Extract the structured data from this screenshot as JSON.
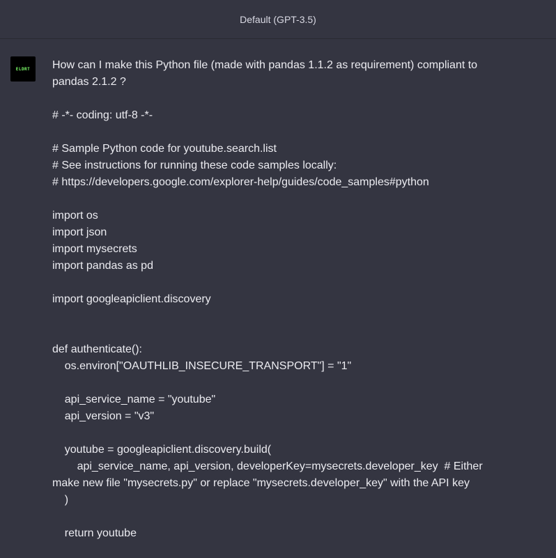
{
  "header": {
    "model_label": "Default (GPT-3.5)"
  },
  "user": {
    "avatar_text": "ELDRT"
  },
  "message": {
    "lines": [
      "How can I make this Python file (made with pandas 1.1.2 as requirement) compliant to pandas 2.1.2 ?",
      "",
      "# -*- coding: utf-8 -*-",
      "",
      "# Sample Python code for youtube.search.list",
      "# See instructions for running these code samples locally:",
      "# https://developers.google.com/explorer-help/guides/code_samples#python",
      "",
      "import os",
      "import json",
      "import mysecrets",
      "import pandas as pd",
      "",
      "import googleapiclient.discovery",
      "",
      "",
      "def authenticate():",
      "    os.environ[\"OAUTHLIB_INSECURE_TRANSPORT\"] = \"1\"",
      "",
      "    api_service_name = \"youtube\"",
      "    api_version = \"v3\"",
      "",
      "    youtube = googleapiclient.discovery.build(",
      "        api_service_name, api_version, developerKey=mysecrets.developer_key  # Either make new file \"mysecrets.py\" or replace \"mysecrets.developer_key\" with the API key",
      "    )",
      "",
      "    return youtube"
    ]
  }
}
